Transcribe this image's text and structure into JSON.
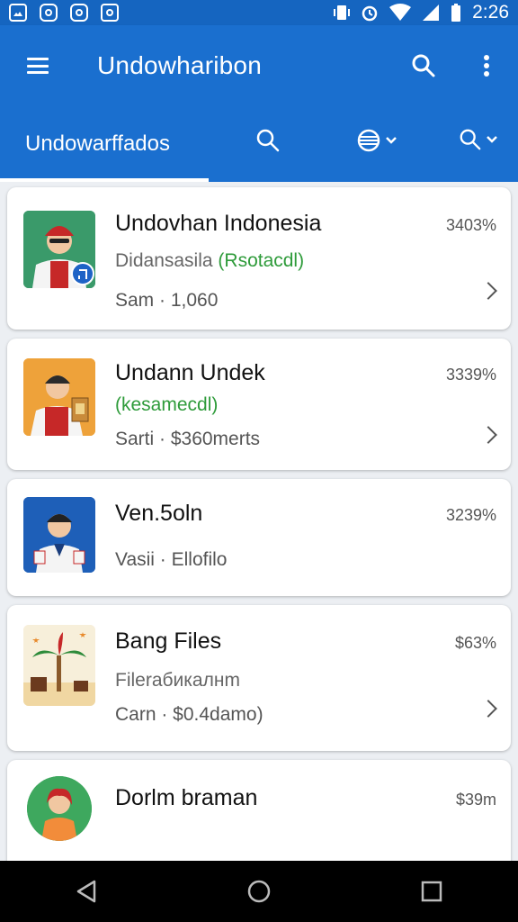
{
  "status_bar": {
    "time": "2:26",
    "notification_icons": [
      "image-icon",
      "circle-app-icon",
      "circle-app-icon",
      "circle-app-icon"
    ],
    "system_icons": [
      "vibrate-icon",
      "alarm-icon",
      "wifi-icon",
      "battery-icon"
    ]
  },
  "app_bar": {
    "title": "Undowharibon",
    "icons": [
      "menu-icon",
      "search-icon",
      "more-vert-icon"
    ]
  },
  "tabs": {
    "active_label": "Undowarffados",
    "icons": [
      "search-icon",
      "globe-dropdown-icon",
      "search-dropdown-icon"
    ]
  },
  "items": [
    {
      "title": "Undovhan Indonesia",
      "sub_prefix": "Didansasila ",
      "sub_highlight": "(Rsotacdl)",
      "meta": "Sam · 1,060",
      "percent": "3403%",
      "has_chevron": true
    },
    {
      "title": "Undann Undek",
      "sub_prefix": "",
      "sub_highlight": "(kesamecdl)",
      "meta": "Sarti · $360merts",
      "percent": "3339%",
      "has_chevron": true
    },
    {
      "title": "Ven.5oln",
      "sub_prefix": "",
      "sub_highlight": "",
      "meta": "Vasii · Ellofilo",
      "percent": "3239%",
      "has_chevron": false
    },
    {
      "title": "Bang Files",
      "sub_prefix": "Fileraбикалнm",
      "sub_highlight": "",
      "meta": "Carn · $0.4damo)",
      "percent": "$63%",
      "has_chevron": true
    },
    {
      "title": "Dorlm braman",
      "sub_prefix": "",
      "sub_highlight": "",
      "meta": "",
      "percent": "$39m",
      "has_chevron": false
    }
  ],
  "nav_bar": {
    "icons": [
      "back-icon",
      "home-icon",
      "recents-icon"
    ]
  },
  "colors": {
    "primary": "#1a6fcf",
    "status_bar": "#1565c0",
    "accent_green": "#2e9b3a",
    "list_background": "#eceff3"
  }
}
